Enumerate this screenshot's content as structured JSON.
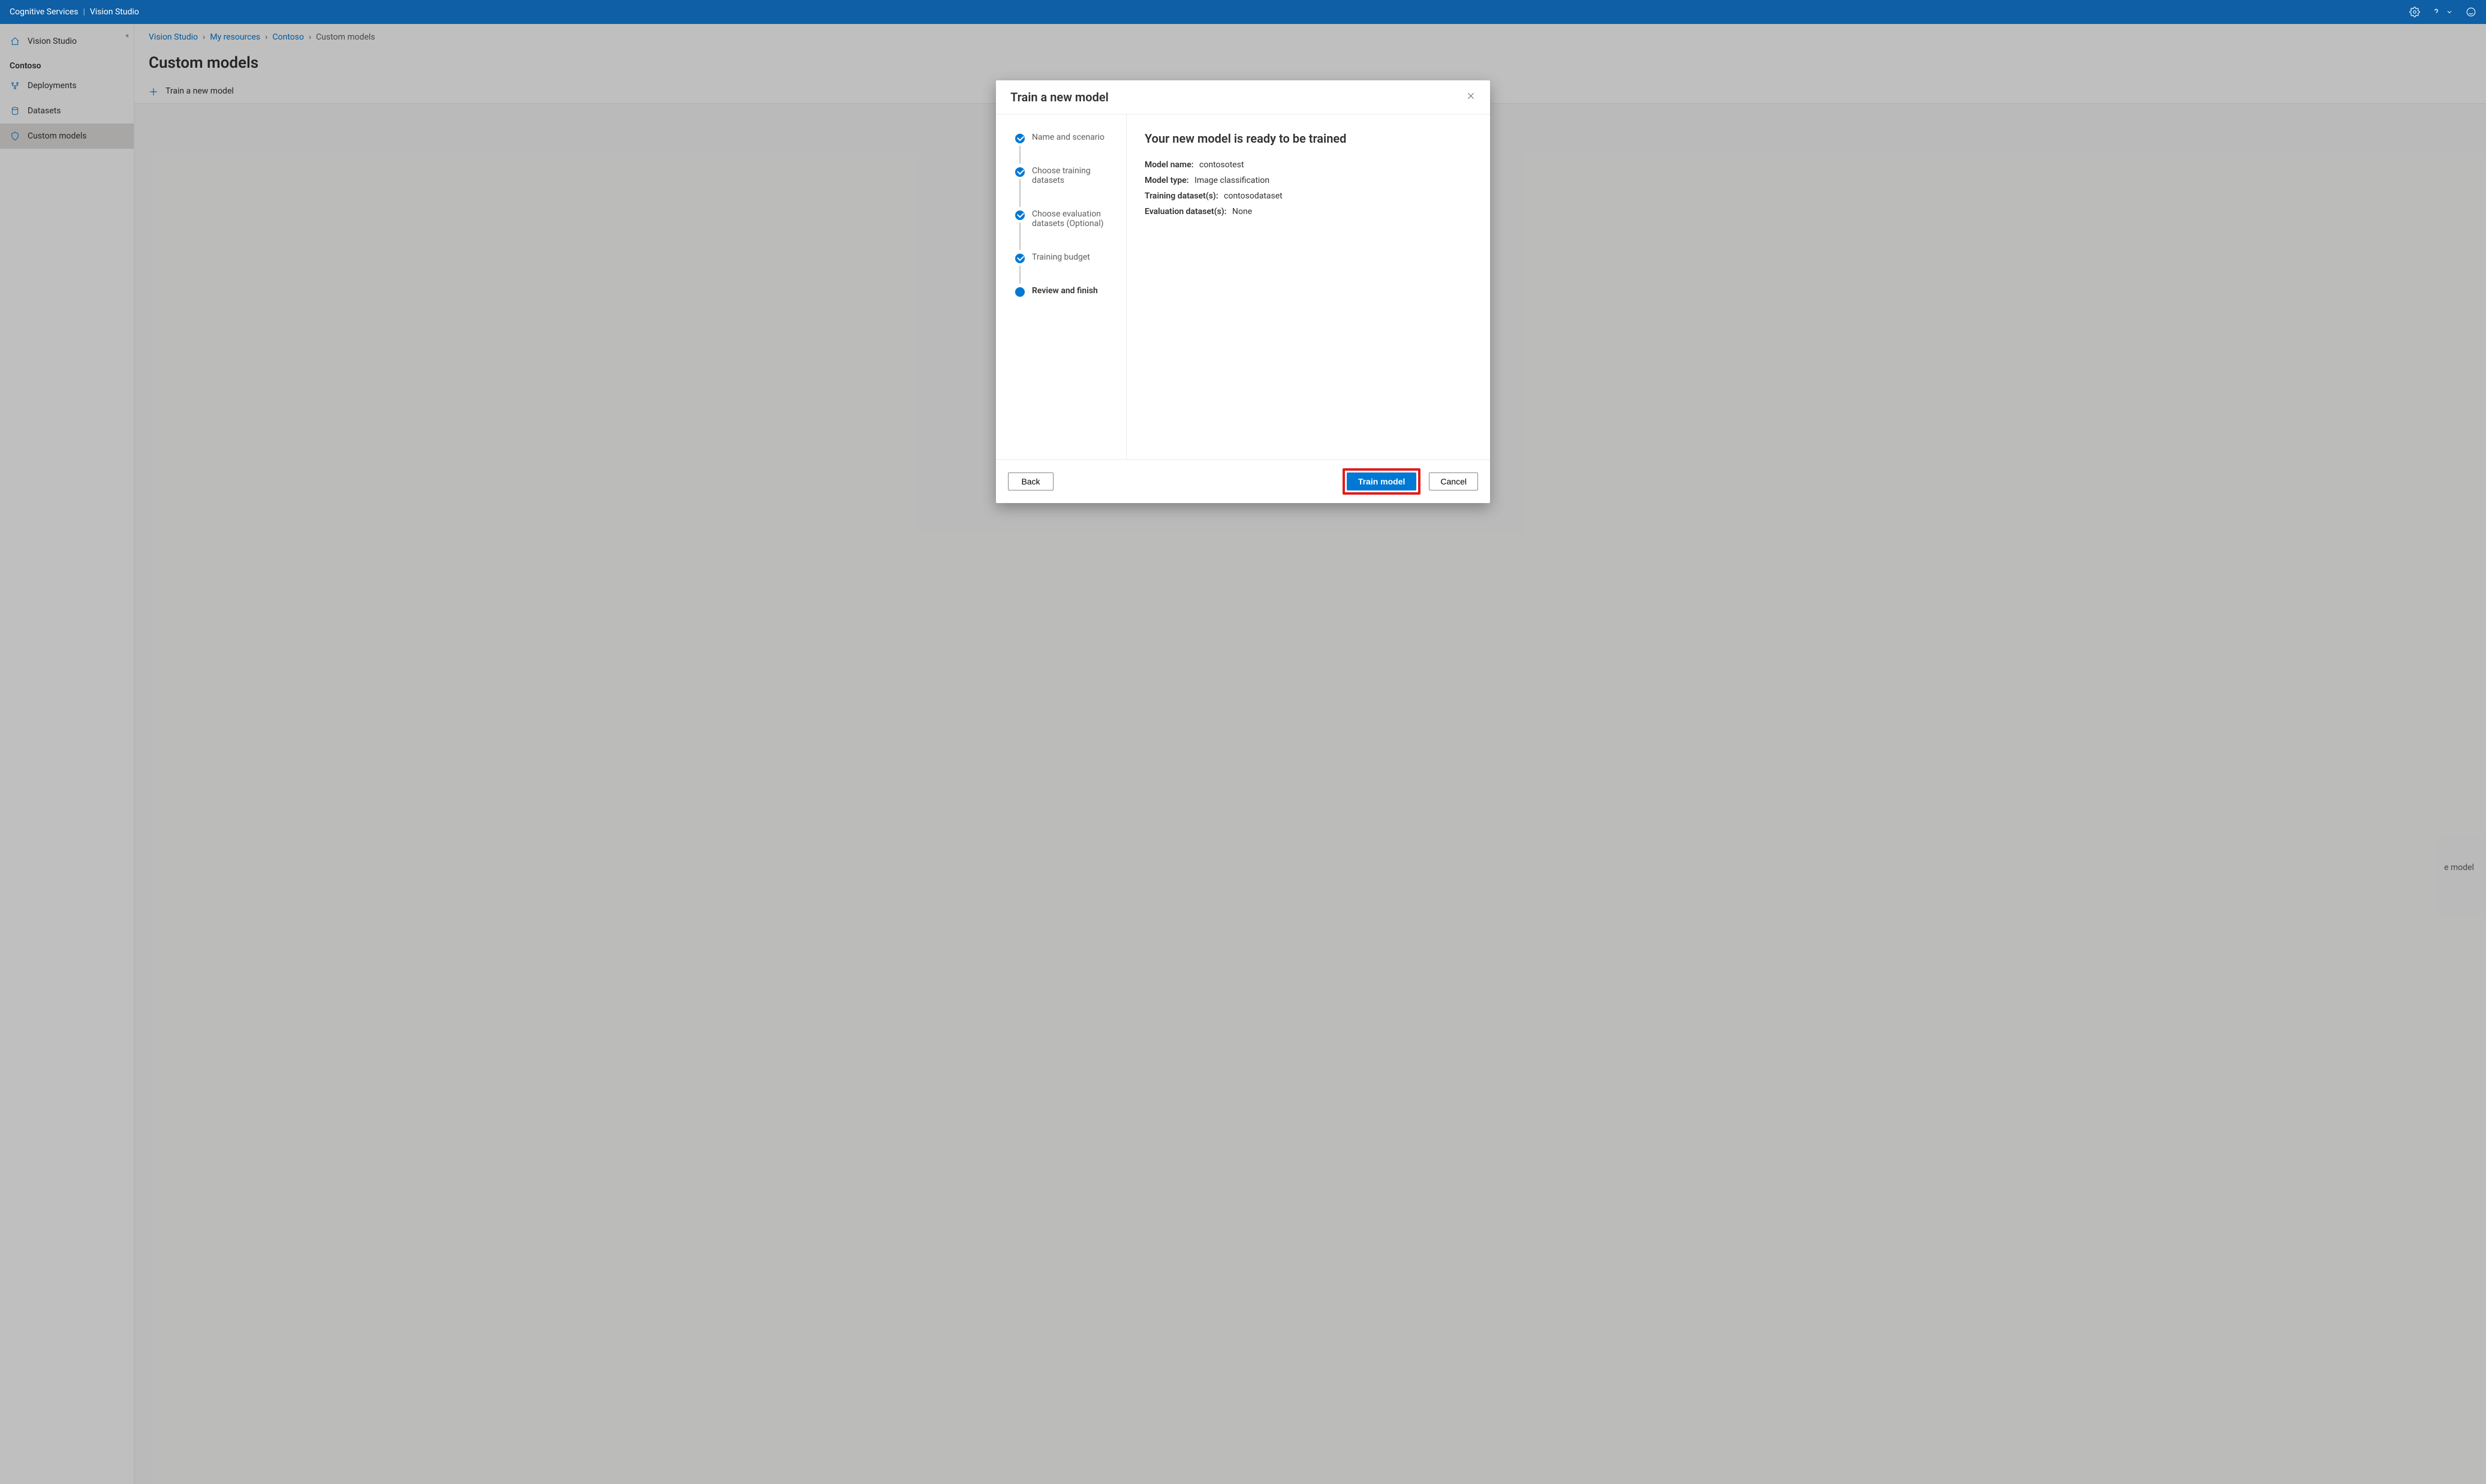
{
  "topbar": {
    "brand": "Cognitive Services",
    "app": "Vision Studio"
  },
  "sidebar": {
    "home_label": "Vision Studio",
    "resource_heading": "Contoso",
    "items": [
      {
        "label": "Deployments"
      },
      {
        "label": "Datasets"
      },
      {
        "label": "Custom models"
      }
    ]
  },
  "breadcrumb": {
    "items": [
      "Vision Studio",
      "My resources",
      "Contoso"
    ],
    "current": "Custom models"
  },
  "page": {
    "title": "Custom models",
    "toolbar_add": "Train a new model"
  },
  "ghost": "e model",
  "modal": {
    "title": "Train a new model",
    "steps": [
      "Name and scenario",
      "Choose training datasets",
      "Choose evaluation datasets (Optional)",
      "Training budget",
      "Review and finish"
    ],
    "review_heading": "Your new model is ready to be trained",
    "summary": {
      "model_name_label": "Model name:",
      "model_name_value": "contosotest",
      "model_type_label": "Model type:",
      "model_type_value": "Image classification",
      "train_ds_label": "Training dataset(s):",
      "train_ds_value": "contosodataset",
      "eval_ds_label": "Evaluation dataset(s):",
      "eval_ds_value": "None"
    },
    "buttons": {
      "back": "Back",
      "train": "Train model",
      "cancel": "Cancel"
    }
  }
}
